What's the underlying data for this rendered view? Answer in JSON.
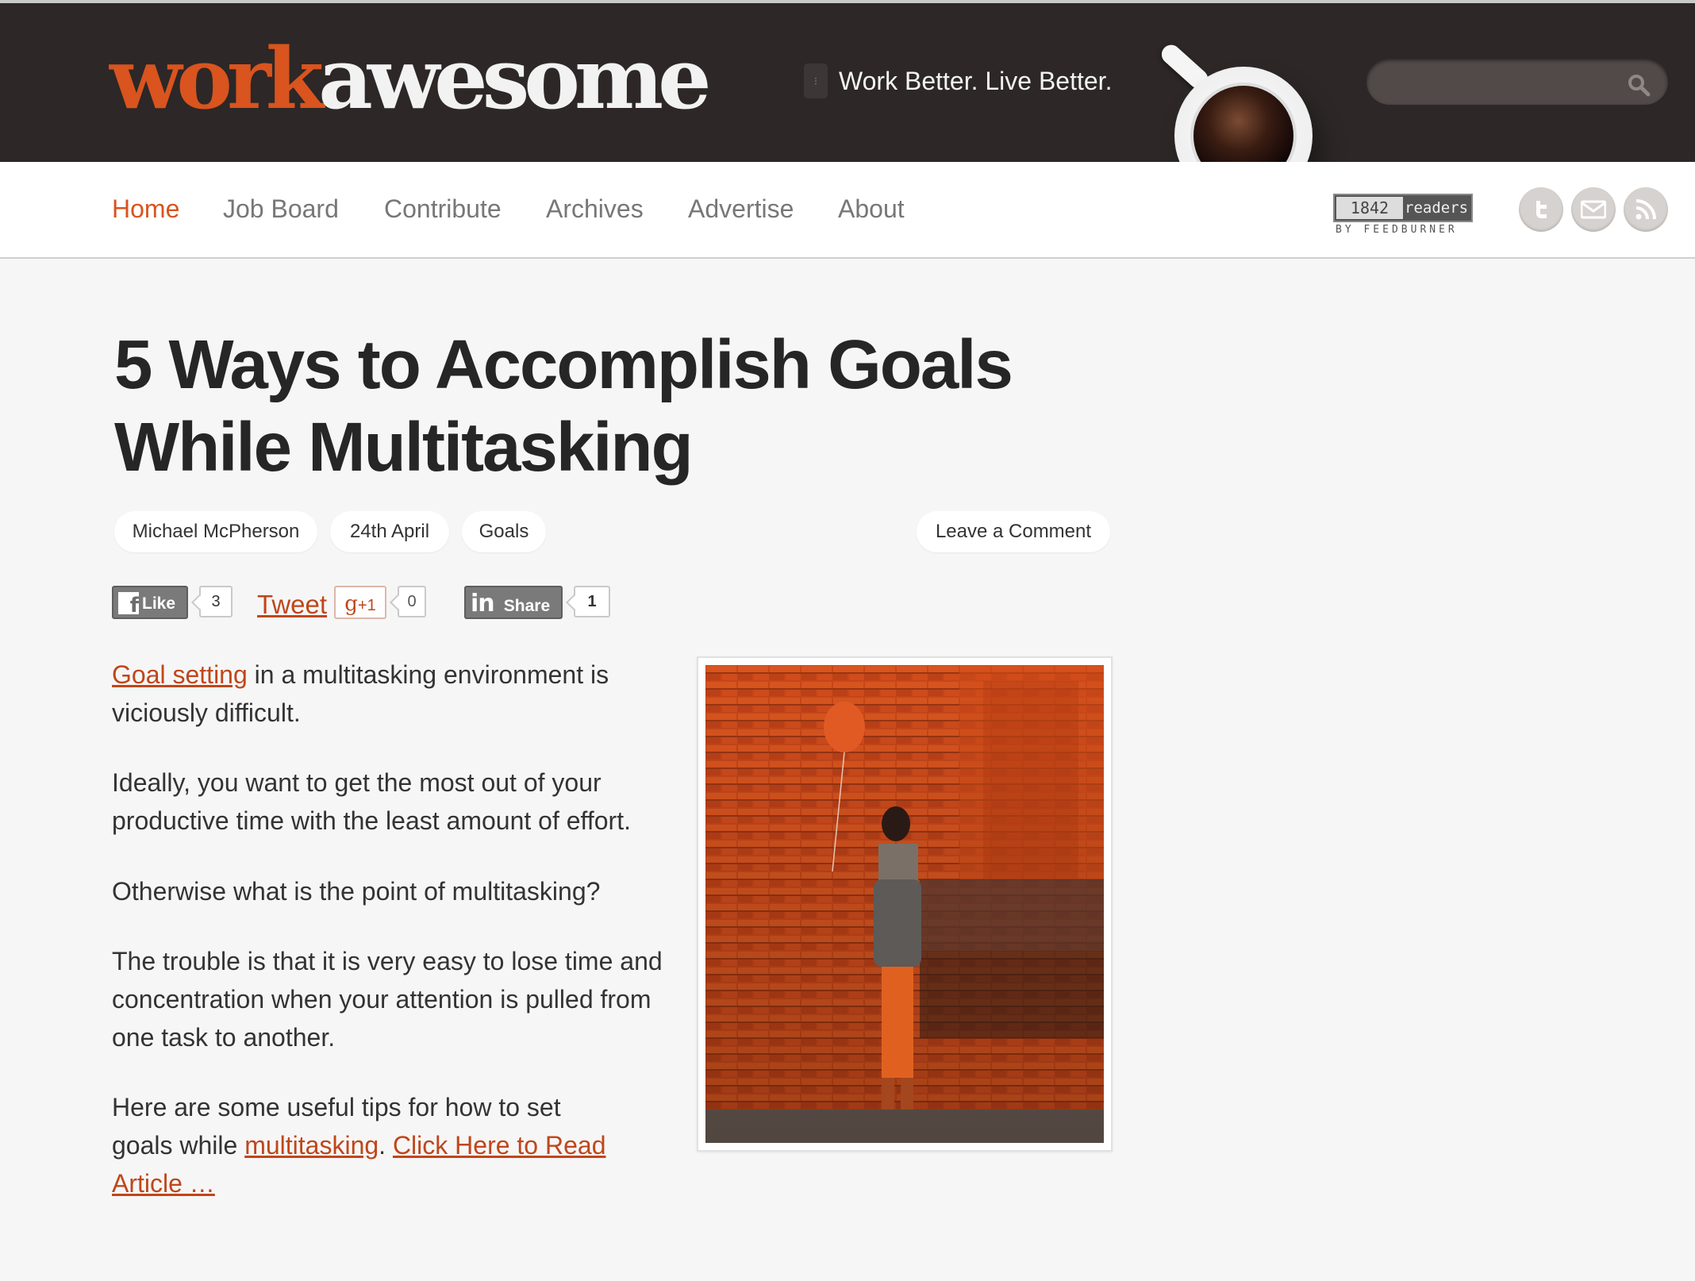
{
  "header": {
    "logo_part1": "work",
    "logo_part2": "awesome",
    "tagline": "Work Better. Live Better.",
    "search_placeholder": ""
  },
  "nav": {
    "items": [
      {
        "label": "Home",
        "active": true
      },
      {
        "label": "Job Board",
        "active": false
      },
      {
        "label": "Contribute",
        "active": false
      },
      {
        "label": "Archives",
        "active": false
      },
      {
        "label": "Advertise",
        "active": false
      },
      {
        "label": "About",
        "active": false
      }
    ],
    "feedburner": {
      "count": "1842",
      "readers": "readers",
      "by": "BY FEEDBURNER"
    },
    "social": [
      "twitter-icon",
      "email-icon",
      "rss-icon"
    ]
  },
  "article": {
    "title": "5 Ways to Accomplish Goals While Multitasking",
    "meta": {
      "author": "Michael McPherson",
      "date": "24th April",
      "category": "Goals",
      "comment": "Leave a Comment"
    },
    "share": {
      "fb_label": "Like",
      "fb_count": "3",
      "tweet_label": "Tweet",
      "gplus_label": "+1",
      "gplus_count": "0",
      "linkedin_label": "Share",
      "linkedin_count": "1"
    },
    "p1_link": "Goal setting",
    "p1_text": " in a multitasking environment is viciously difficult.",
    "p2": "Ideally, you want to get the most out of your productive time with the least amount of effort.",
    "p3": "Otherwise what is the point of multitasking?",
    "p4": "The trouble is that it is very easy to lose time and concentration when your attention is pulled from one task to another.",
    "p5_text": "Here are some useful tips for how to set goals while ",
    "p5_link": "multitasking",
    "p5_dot": ". ",
    "p5_read": "Click Here to Read Article …"
  },
  "colors": {
    "accent": "#d9541e",
    "header_bg": "#2d2727",
    "link": "#c0461a",
    "page_bg": "#f6f6f6"
  }
}
